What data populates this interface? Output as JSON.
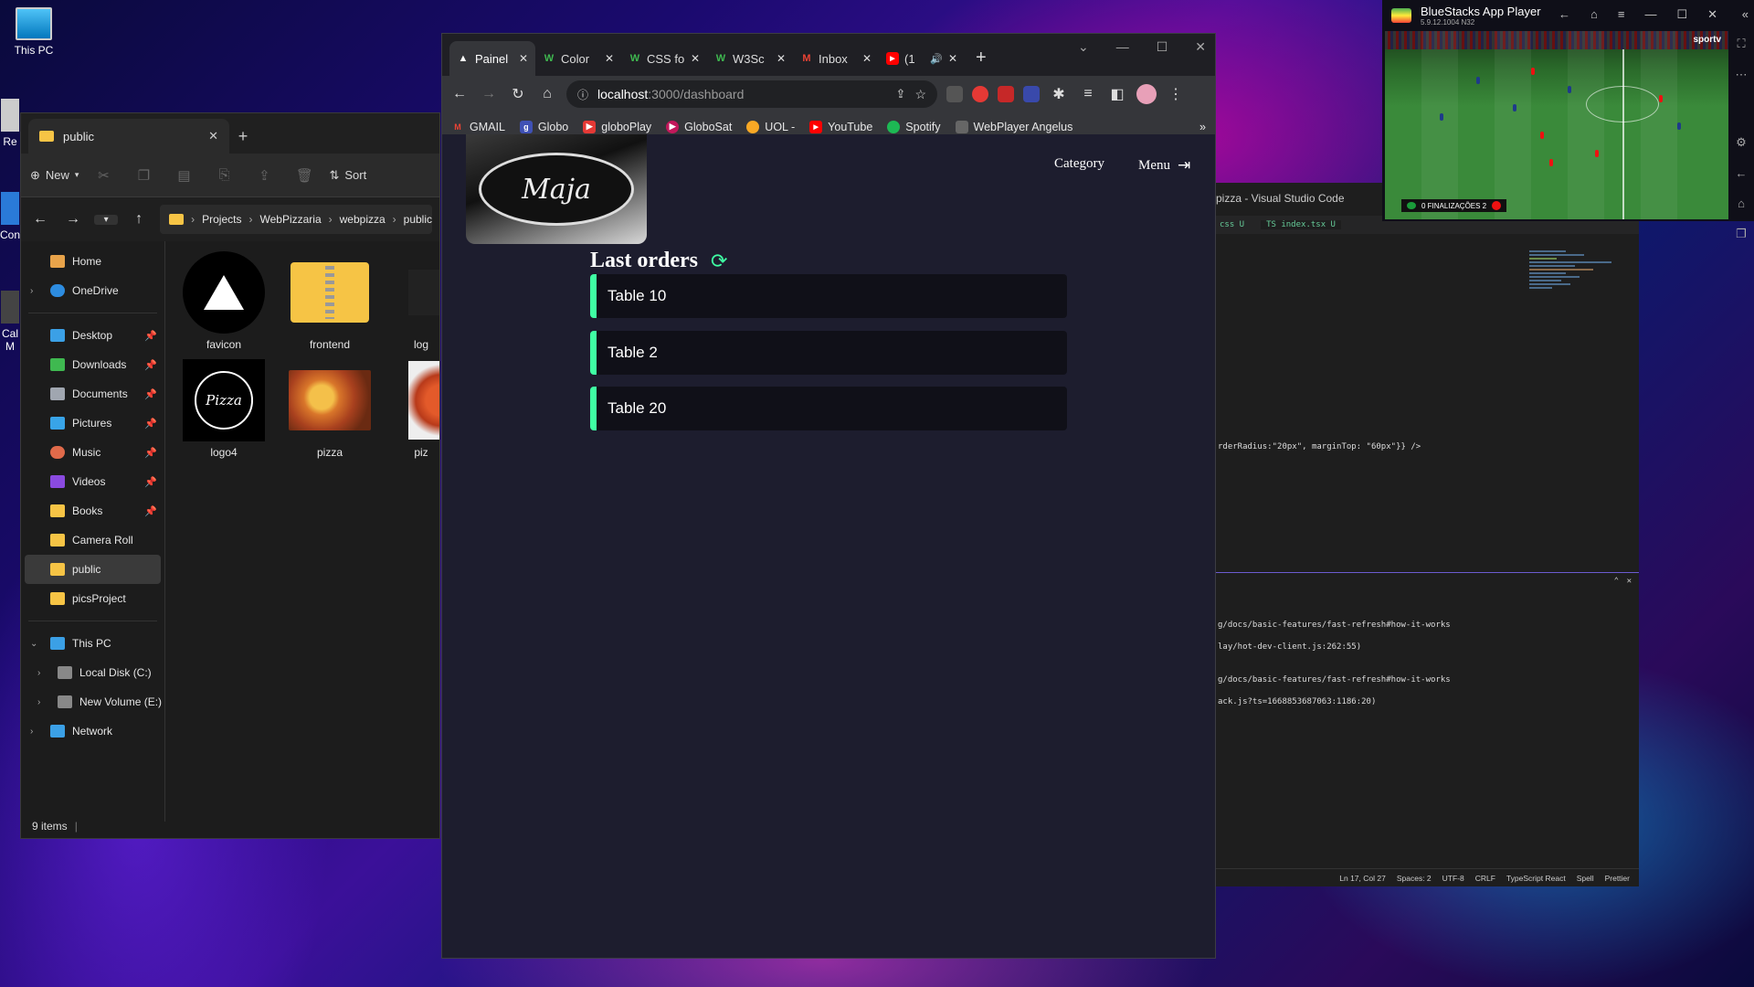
{
  "desktop": {
    "icons": [
      {
        "label": "This PC"
      },
      {
        "label": "Re"
      },
      {
        "label": "Con"
      },
      {
        "label": "Cal M"
      }
    ]
  },
  "explorer": {
    "tab_title": "public",
    "toolbar": {
      "new_label": "New",
      "sort_label": "Sort"
    },
    "breadcrumb": [
      "Projects",
      "WebPizzaria",
      "webpizza",
      "public"
    ],
    "sidebar": [
      {
        "label": "Home",
        "pinned": false
      },
      {
        "label": "OneDrive",
        "pinned": false
      },
      {
        "label": "Desktop",
        "pinned": true
      },
      {
        "label": "Downloads",
        "pinned": true
      },
      {
        "label": "Documents",
        "pinned": true
      },
      {
        "label": "Pictures",
        "pinned": true
      },
      {
        "label": "Music",
        "pinned": true
      },
      {
        "label": "Videos",
        "pinned": true
      },
      {
        "label": "Books",
        "pinned": true
      },
      {
        "label": "Camera Roll",
        "pinned": false
      },
      {
        "label": "public",
        "pinned": false
      },
      {
        "label": "picsProject",
        "pinned": false
      },
      {
        "label": "This PC",
        "pinned": false
      },
      {
        "label": "Local Disk (C:)",
        "pinned": false
      },
      {
        "label": "New Volume (E:)",
        "pinned": false
      },
      {
        "label": "Network",
        "pinned": false
      }
    ],
    "files": [
      {
        "label": "favicon"
      },
      {
        "label": "frontend"
      },
      {
        "label": "log"
      },
      {
        "label": "logo4"
      },
      {
        "label": "pizza"
      },
      {
        "label": "piz"
      }
    ],
    "status": "9 items"
  },
  "browser": {
    "tabs": [
      {
        "label": "Painel"
      },
      {
        "label": "Color"
      },
      {
        "label": "CSS fo"
      },
      {
        "label": "W3Sc"
      },
      {
        "label": "Inbox"
      },
      {
        "label": "(1"
      }
    ],
    "url_host": "localhost",
    "url_path": ":3000/dashboard",
    "bookmarks": [
      {
        "label": "GMAIL"
      },
      {
        "label": "Globo"
      },
      {
        "label": "globoPlay"
      },
      {
        "label": "GloboSat"
      },
      {
        "label": "UOL -"
      },
      {
        "label": "YouTube"
      },
      {
        "label": "Spotify"
      },
      {
        "label": "WebPlayer Angelus"
      }
    ],
    "page": {
      "logo_text": "Maja",
      "nav": {
        "category": "Category",
        "menu": "Menu"
      },
      "orders_title": "Last orders",
      "orders": [
        {
          "label": "Table 10"
        },
        {
          "label": "Table 2"
        },
        {
          "label": "Table 20"
        }
      ],
      "accent": "#3fffa3"
    }
  },
  "vscode": {
    "title": "pizza - Visual Studio Code",
    "tabs": [
      "css U",
      "TS index.tsx U"
    ],
    "code_line": "rderRadius:\"20px\", marginTop: \"60px\"}} />",
    "terminal": [
      "g/docs/basic-features/fast-refresh#how-it-works",
      "lay/hot-dev-client.js:262:55)",
      "g/docs/basic-features/fast-refresh#how-it-works",
      "ack.js?ts=1668853687063:1186:20)"
    ],
    "status": [
      "Ln 17, Col 27",
      "Spaces: 2",
      "UTF-8",
      "CRLF",
      "TypeScript React",
      "Spell",
      "Prettier"
    ]
  },
  "bluestacks": {
    "title": "BlueStacks App Player",
    "version": "5.9.12.1004  N32",
    "channel": "sportv",
    "score": "0  FINALIZAÇÕES  2"
  }
}
